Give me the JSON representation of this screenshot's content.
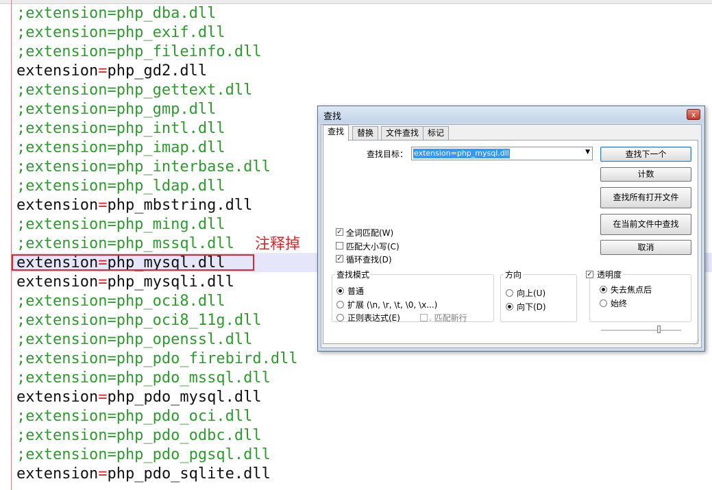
{
  "editor": {
    "lines": [
      {
        "text": ";extension=php_dba.dll",
        "commented": true
      },
      {
        "text": ";extension=php_exif.dll",
        "commented": true
      },
      {
        "text": ";extension=php_fileinfo.dll",
        "commented": true
      },
      {
        "text": "extension=php_gd2.dll",
        "commented": false
      },
      {
        "text": ";extension=php_gettext.dll",
        "commented": true
      },
      {
        "text": ";extension=php_gmp.dll",
        "commented": true
      },
      {
        "text": ";extension=php_intl.dll",
        "commented": true
      },
      {
        "text": ";extension=php_imap.dll",
        "commented": true
      },
      {
        "text": ";extension=php_interbase.dll",
        "commented": true
      },
      {
        "text": ";extension=php_ldap.dll",
        "commented": true
      },
      {
        "text": "extension=php_mbstring.dll",
        "commented": false
      },
      {
        "text": ";extension=php_ming.dll",
        "commented": true
      },
      {
        "text": ";extension=php_mssql.dll",
        "commented": true
      },
      {
        "text": "extension=php_mysql.dll",
        "commented": false
      },
      {
        "text": "extension=php_mysqli.dll",
        "commented": false
      },
      {
        "text": ";extension=php_oci8.dll",
        "commented": true
      },
      {
        "text": ";extension=php_oci8_11g.dll",
        "commented": true
      },
      {
        "text": ";extension=php_openssl.dll",
        "commented": true
      },
      {
        "text": ";extension=php_pdo_firebird.dll",
        "commented": true
      },
      {
        "text": ";extension=php_pdo_mssql.dll",
        "commented": true
      },
      {
        "text": "extension=php_pdo_mysql.dll",
        "commented": false
      },
      {
        "text": ";extension=php_pdo_oci.dll",
        "commented": true
      },
      {
        "text": ";extension=php_pdo_odbc.dll",
        "commented": true
      },
      {
        "text": ";extension=php_pdo_pgsql.dll",
        "commented": true
      },
      {
        "text": "extension=php_pdo_sqlite.dll",
        "commented": false
      }
    ],
    "annotation": "注释掉",
    "colors": {
      "commented": "#2f9a2f",
      "active": "#111111",
      "operator": "#e0252b",
      "annotation": "#e0252b"
    }
  },
  "dialog": {
    "title": "查找",
    "close_glyph": "x",
    "tabs": [
      "查找",
      "替换",
      "文件查找",
      "标记"
    ],
    "search_label": "查找目标：",
    "search_value": "extension=php_mysql.dll",
    "buttons": {
      "find_next": "查找下一个",
      "count": "计数",
      "find_all_open": "查找所有打开文件",
      "find_in_current": "在当前文件中查找",
      "cancel": "取消"
    },
    "options": {
      "whole_word": {
        "label": "全词匹配(W)",
        "checked": true
      },
      "match_case": {
        "label": "匹配大小写(C)",
        "checked": false
      },
      "wrap_around": {
        "label": "循环查找(D)",
        "checked": true
      }
    },
    "search_mode": {
      "title": "查找模式",
      "normal": "普通",
      "extended": "扩展 (\\n, \\r, \\t, \\0, \\x...)",
      "regex": "正则表达式(E)",
      "dot_newline": ". 匹配新行",
      "selected": "normal"
    },
    "direction": {
      "title": "方向",
      "up": "向上(U)",
      "down": "向下(D)",
      "selected": "down"
    },
    "transparency": {
      "title": "透明度",
      "checked": true,
      "on_lose_focus": "失去焦点后",
      "always": "始终",
      "selected": "on_lose_focus"
    }
  }
}
